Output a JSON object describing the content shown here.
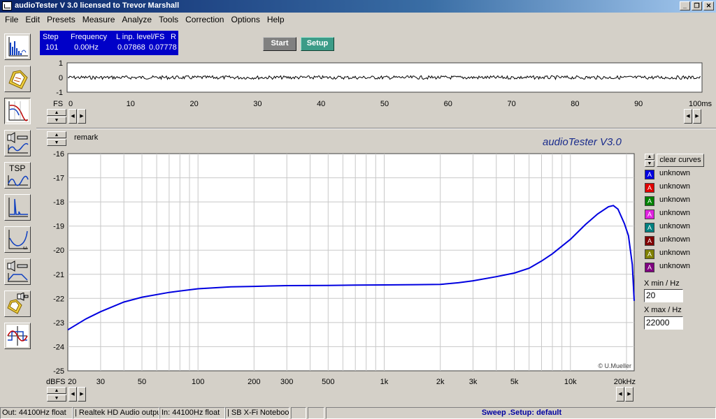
{
  "window": {
    "title": "audioTester  V 3.0   licensed to Trevor Marshall",
    "minimize": "_",
    "restore": "❐",
    "close": "✕"
  },
  "menu": [
    "File",
    "Edit",
    "Presets",
    "Measure",
    "Analyze",
    "Tools",
    "Correction",
    "Options",
    "Help"
  ],
  "status_display": {
    "headers": [
      "Step",
      "Frequency",
      "L  inp. level/FS",
      "R"
    ],
    "values": [
      "101",
      "0.00Hz",
      "0.07868",
      "0.07778"
    ]
  },
  "buttons": {
    "start": "Start",
    "setup": "Setup",
    "clear_curves": "clear curves"
  },
  "toolbar_icons": [
    "spectrum-icon",
    "folder-open-icon",
    "filter-response-icon",
    "speaker-measure-icon",
    "tsp-icon",
    "impulse-icon",
    "impedance-icon",
    "speaker-response-icon",
    "folder-speaker-icon",
    "distortion-icon"
  ],
  "tsp_label": "TSP",
  "scope": {
    "y_ticks": [
      "1",
      "0",
      "-1"
    ],
    "x_ticks": [
      "0",
      "10",
      "20",
      "30",
      "40",
      "50",
      "60",
      "70",
      "80",
      "90"
    ],
    "x_unit_left": "FS",
    "x_unit_right": "100ms"
  },
  "main_plot": {
    "remark": "remark",
    "brand": "audioTester  V3.0",
    "copyright": "© U.Mueller",
    "y_unit": "dBFS",
    "y_ticks": [
      "-16",
      "-17",
      "-18",
      "-19",
      "-20",
      "-21",
      "-22",
      "-23",
      "-24",
      "-25"
    ],
    "x_ticks": [
      "20",
      "30",
      "50",
      "100",
      "200",
      "300",
      "500",
      "1k",
      "2k",
      "3k",
      "5k",
      "10k",
      "20kHz"
    ]
  },
  "legend": [
    {
      "label": "unknown",
      "color": "#0000e0"
    },
    {
      "label": "unknown",
      "color": "#e00000"
    },
    {
      "label": "unknown",
      "color": "#008000"
    },
    {
      "label": "unknown",
      "color": "#e020e0"
    },
    {
      "label": "unknown",
      "color": "#008080"
    },
    {
      "label": "unknown",
      "color": "#800000"
    },
    {
      "label": "unknown",
      "color": "#808000"
    },
    {
      "label": "unknown",
      "color": "#800080"
    }
  ],
  "legend_glyph": "A",
  "x_limits": {
    "min_label": "X min / Hz",
    "min_value": "20",
    "max_label": "X max / Hz",
    "max_value": "22000"
  },
  "statusbar": {
    "out": "Out: 44100Hz float",
    "out_device": "| Realtek HD Audio output",
    "in": "In: 44100Hz float",
    "in_device": "| SB X-Fi Notebook",
    "sweep": "Sweep  .Setup:  default"
  },
  "chart_data": {
    "type": "line",
    "x_scale": "log",
    "xlim": [
      20,
      22000
    ],
    "ylim": [
      -25,
      -16
    ],
    "ylabel": "dBFS",
    "grid": true,
    "series": [
      {
        "color": "#0000e0",
        "x": [
          20,
          25,
          30,
          40,
          50,
          70,
          100,
          150,
          200,
          300,
          500,
          700,
          1000,
          1500,
          2000,
          2500,
          3000,
          4000,
          5000,
          6000,
          7000,
          8000,
          10000,
          12000,
          14000,
          16000,
          17000,
          18000,
          19500,
          20500,
          21500,
          22000
        ],
        "y": [
          -23.3,
          -22.85,
          -22.55,
          -22.15,
          -21.95,
          -21.75,
          -21.6,
          -21.52,
          -21.5,
          -21.47,
          -21.46,
          -21.45,
          -21.44,
          -21.43,
          -21.42,
          -21.35,
          -21.27,
          -21.1,
          -20.95,
          -20.75,
          -20.45,
          -20.15,
          -19.55,
          -18.95,
          -18.5,
          -18.2,
          -18.15,
          -18.3,
          -18.9,
          -19.4,
          -20.6,
          -22.1
        ]
      }
    ]
  }
}
